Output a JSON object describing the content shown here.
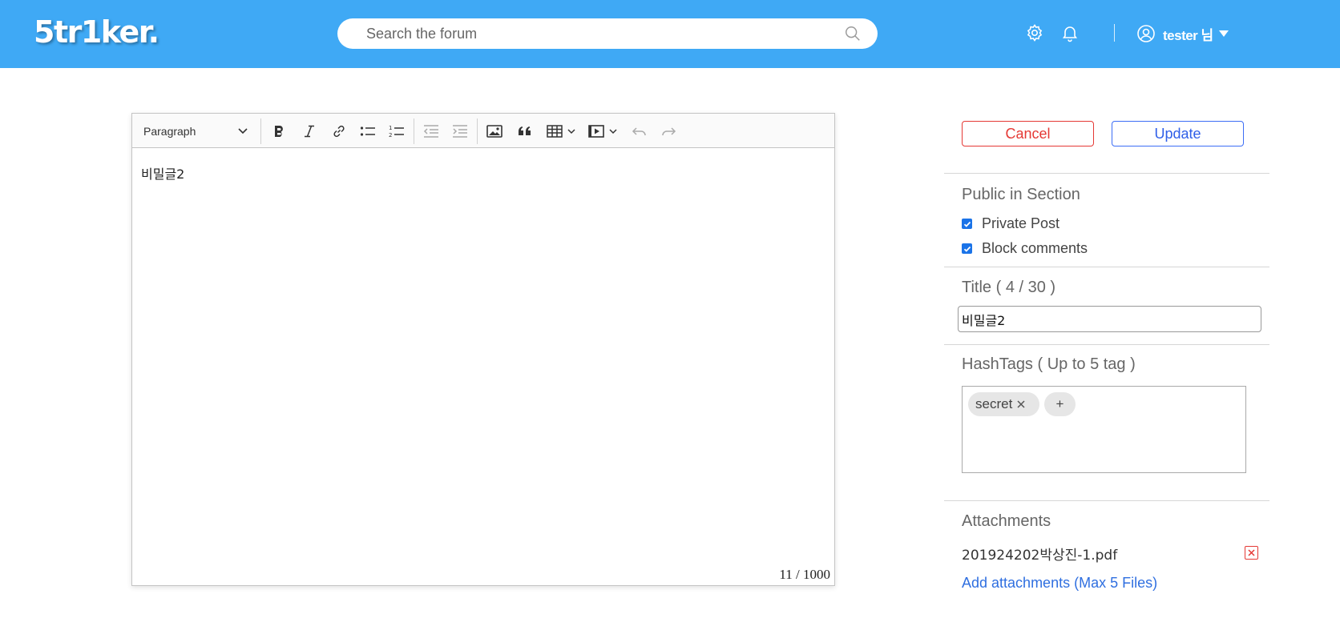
{
  "header": {
    "logo": "5tr1ker.",
    "search_placeholder": "Search the forum",
    "user_name": "tester 님",
    "icons": [
      "gear-icon",
      "bell-icon",
      "user-circle-icon",
      "caret-down-icon",
      "search-icon"
    ]
  },
  "editor": {
    "heading_select": "Paragraph",
    "toolbar_icons": [
      "bold-icon",
      "italic-icon",
      "link-icon",
      "bulleted-list-icon",
      "numbered-list-icon",
      "outdent-icon",
      "indent-icon",
      "image-icon",
      "blockquote-icon",
      "table-icon",
      "media-icon",
      "undo-icon",
      "redo-icon"
    ],
    "content": "비밀글2",
    "char_count": "11 / 1000"
  },
  "actions": {
    "cancel_label": "Cancel",
    "update_label": "Update"
  },
  "public_section": {
    "title": "Public in Section",
    "private_post_label": "Private Post",
    "private_post_checked": true,
    "block_comments_label": "Block comments",
    "block_comments_checked": true
  },
  "title_section": {
    "label": "Title ( 4 / 30 )",
    "value": "비밀글2"
  },
  "hashtags": {
    "label": "HashTags ( Up to 5 tag )",
    "tags": [
      "secret"
    ],
    "add_label": "+"
  },
  "attachments": {
    "label": "Attachments",
    "files": [
      "201924202박상진-1.pdf"
    ],
    "add_link": "Add attachments (Max 5 Files)"
  },
  "colors": {
    "header_bg": "#3fa9f5",
    "cancel": "#e53935",
    "update": "#2f5fe8",
    "link": "#2f6fe0",
    "checkbox": "#1a73e8"
  }
}
